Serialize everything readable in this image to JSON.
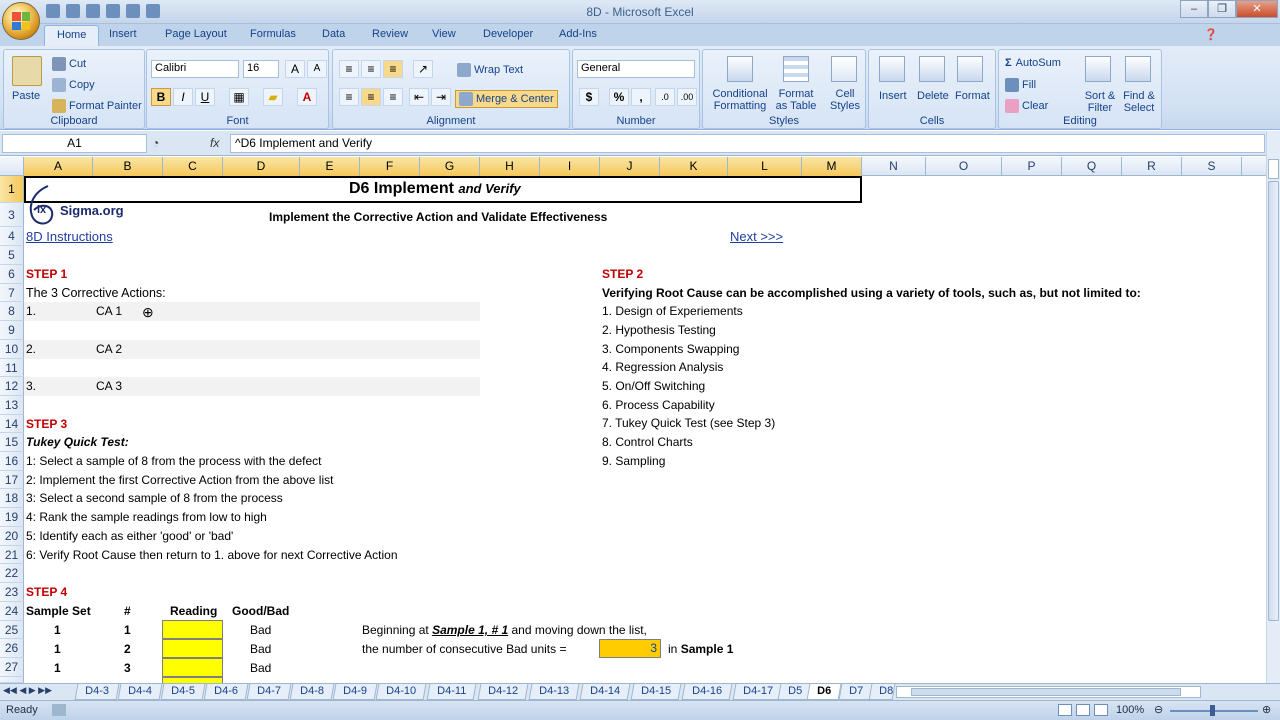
{
  "window": {
    "title": "8D - Microsoft Excel"
  },
  "ribbon": {
    "tabs": [
      "Home",
      "Insert",
      "Page Layout",
      "Formulas",
      "Data",
      "Review",
      "View",
      "Developer",
      "Add-Ins"
    ],
    "clipboard": {
      "label": "Clipboard",
      "paste": "Paste",
      "cut": "Cut",
      "copy": "Copy",
      "format_painter": "Format Painter"
    },
    "font": {
      "label": "Font",
      "name": "Calibri",
      "size": "16",
      "bold": "B",
      "italic": "I",
      "underline": "U"
    },
    "alignment": {
      "label": "Alignment",
      "wrap": "Wrap Text",
      "merge": "Merge & Center"
    },
    "number": {
      "label": "Number",
      "format": "General",
      "currency": "$",
      "percent": "%",
      "comma": ","
    },
    "styles": {
      "label": "Styles",
      "conditional": "Conditional Formatting",
      "format_table": "Format as Table",
      "cell_styles": "Cell Styles"
    },
    "cells": {
      "label": "Cells",
      "insert": "Insert",
      "delete": "Delete",
      "format": "Format"
    },
    "editing": {
      "label": "Editing",
      "autosum": "AutoSum",
      "fill": "Fill",
      "clear": "Clear",
      "sort": "Sort & Filter",
      "find": "Find & Select"
    }
  },
  "formula_bar": {
    "name_box": "A1",
    "fx": "fx",
    "content": "^D6 Implement and Verify"
  },
  "columns": [
    "A",
    "B",
    "C",
    "D",
    "E",
    "F",
    "G",
    "H",
    "I",
    "J",
    "K",
    "L",
    "M",
    "N",
    "O",
    "P",
    "Q",
    "R",
    "S"
  ],
  "rows": [
    "1",
    "3",
    "4",
    "5",
    "6",
    "7",
    "8",
    "9",
    "10",
    "11",
    "12",
    "13",
    "14",
    "15",
    "16",
    "17",
    "18",
    "19",
    "20",
    "21",
    "22",
    "23",
    "24",
    "25",
    "26",
    "27"
  ],
  "sheet": {
    "title_main": "D6 Implement",
    "title_sub": "and Verify",
    "logo_text": "Sigma.org",
    "logo_prefix": "ix",
    "subtitle": "Implement the Corrective Action and Validate Effectiveness",
    "instructions_link": "8D Instructions",
    "next_link": "Next >>>",
    "step1": "STEP 1",
    "ca_heading": "The 3 Corrective Actions:",
    "ca": [
      {
        "num": "1.",
        "label": "CA 1"
      },
      {
        "num": "2.",
        "label": "CA 2"
      },
      {
        "num": "3.",
        "label": "CA 3"
      }
    ],
    "step2": "STEP 2",
    "verify_heading": "Verifying Root Cause can be accomplished using a variety of tools, such as, but not limited to:",
    "tools": [
      "1. Design of Experiements",
      "2. Hypothesis Testing",
      "3. Components Swapping",
      "4. Regression Analysis",
      "5. On/Off Switching",
      "6. Process Capability",
      "7. Tukey Quick Test (see Step 3)",
      "8. Control Charts",
      "9. Sampling"
    ],
    "step3": "STEP 3",
    "tukey_heading": "Tukey Quick Test:",
    "tukey_steps": [
      "1: Select a sample of 8 from the process with the defect",
      "2: Implement the first Corrective Action from the above list",
      "3: Select a second sample of 8 from the process",
      "4: Rank the sample readings from low to high",
      "5: Identify each as either 'good' or 'bad'",
      "6: Verify Root Cause then return to 1. above for next Corrective Action"
    ],
    "step4": "STEP 4",
    "table_headers": {
      "set": "Sample Set",
      "num": "#",
      "reading": "Reading",
      "goodbad": "Good/Bad"
    },
    "table_rows": [
      {
        "set": "1",
        "num": "1",
        "goodbad": "Bad"
      },
      {
        "set": "1",
        "num": "2",
        "goodbad": "Bad"
      },
      {
        "set": "1",
        "num": "3",
        "goodbad": "Bad"
      }
    ],
    "note_line1_pre": "Beginning at",
    "note_line1_em": "Sample 1, # 1",
    "note_line1_post": "and moving down the list,",
    "note_line2": "the number of consecutive Bad units  =",
    "consecutive_value": "3",
    "in_sample": "in",
    "in_sample_bold": "Sample 1"
  },
  "sheet_tabs": [
    "D4-3",
    "D4-4",
    "D4-5",
    "D4-6",
    "D4-7",
    "D4-8",
    "D4-9",
    "D4-10",
    "D4-11",
    "D4-12",
    "D4-13",
    "D4-14",
    "D4-15",
    "D4-16",
    "D4-17",
    "D5",
    "D6",
    "D7",
    "D8"
  ],
  "active_sheet": "D6",
  "status": {
    "ready": "Ready",
    "zoom": "100%"
  }
}
